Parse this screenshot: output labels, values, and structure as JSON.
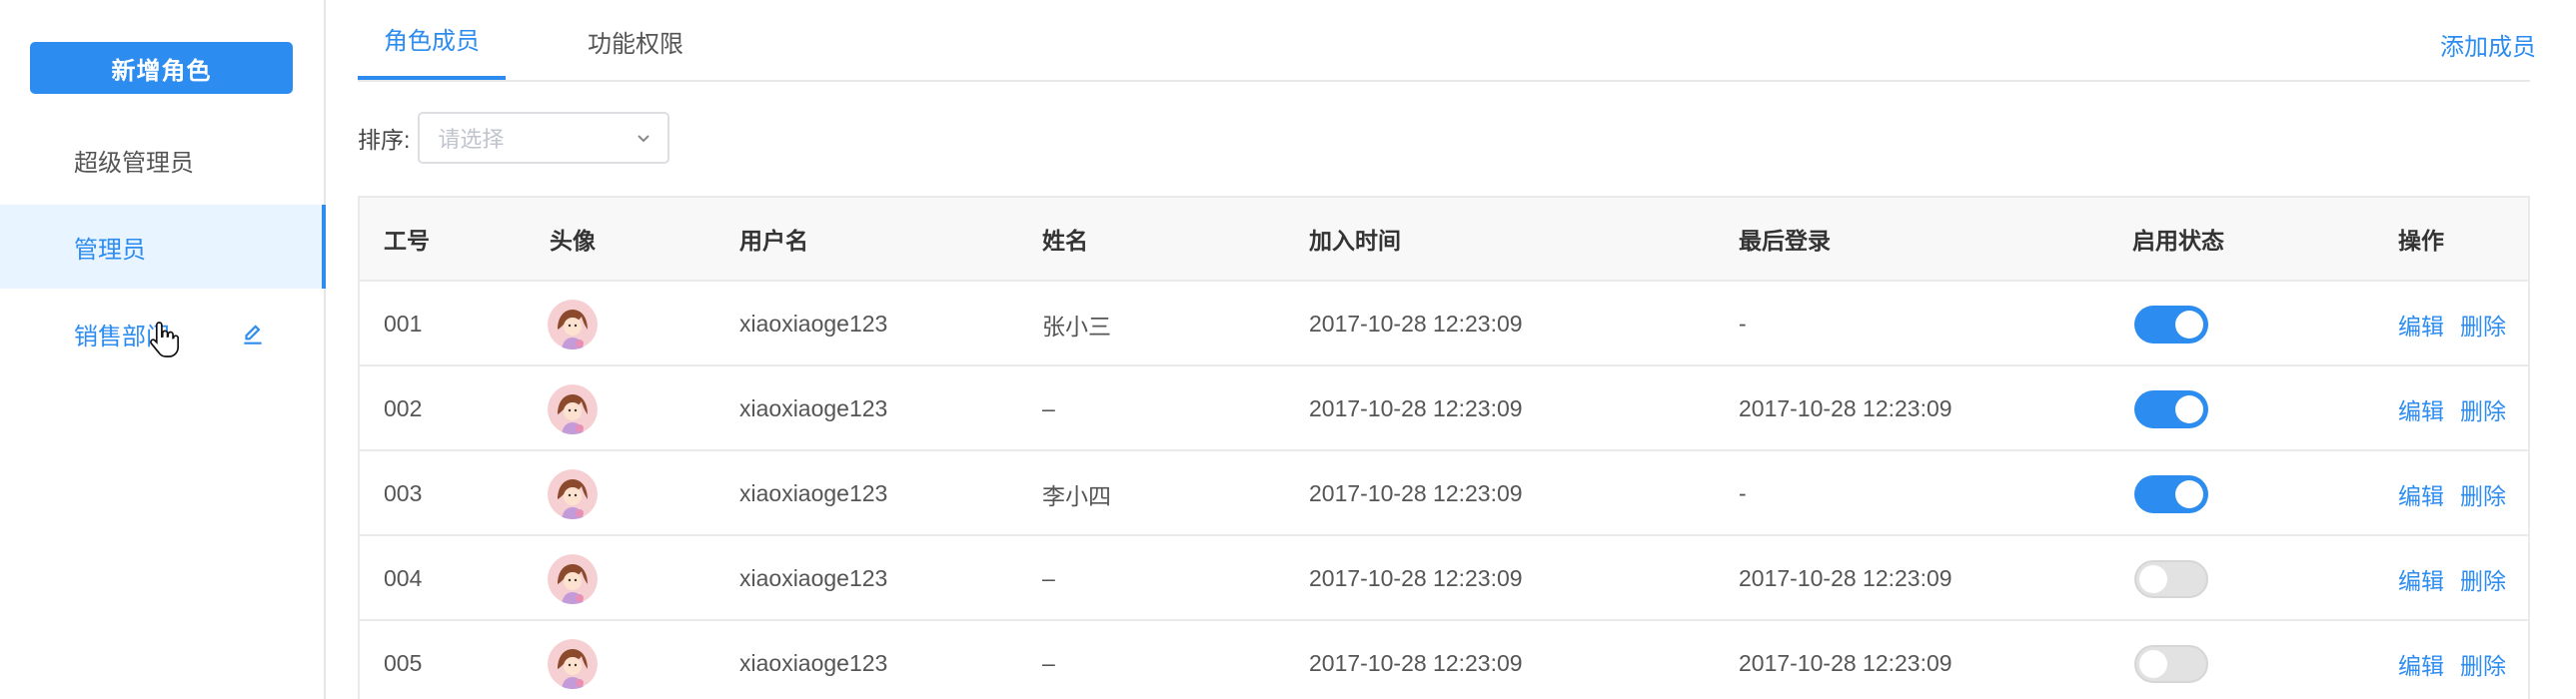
{
  "sidebar": {
    "new_role_label": "新增角色",
    "items": [
      {
        "label": "超级管理员"
      },
      {
        "label": "管理员"
      },
      {
        "label": "销售部门"
      }
    ]
  },
  "tabs": [
    {
      "label": "角色成员"
    },
    {
      "label": "功能权限"
    }
  ],
  "add_member_label": "添加成员",
  "sort": {
    "label": "排序:",
    "placeholder": "请选择"
  },
  "table": {
    "headers": [
      "工号",
      "头像",
      "用户名",
      "姓名",
      "加入时间",
      "最后登录",
      "启用状态",
      "操作"
    ],
    "rows": [
      {
        "id": "001",
        "username": "xiaoxiaoge123",
        "name": "张小三",
        "joined": "2017-10-28 12:23:09",
        "last_login": "-",
        "enabled": true
      },
      {
        "id": "002",
        "username": "xiaoxiaoge123",
        "name": "–",
        "joined": "2017-10-28 12:23:09",
        "last_login": "2017-10-28 12:23:09",
        "enabled": true
      },
      {
        "id": "003",
        "username": "xiaoxiaoge123",
        "name": "李小四",
        "joined": "2017-10-28 12:23:09",
        "last_login": "-",
        "enabled": true
      },
      {
        "id": "004",
        "username": "xiaoxiaoge123",
        "name": "–",
        "joined": "2017-10-28 12:23:09",
        "last_login": "2017-10-28 12:23:09",
        "enabled": false
      },
      {
        "id": "005",
        "username": "xiaoxiaoge123",
        "name": "–",
        "joined": "2017-10-28 12:23:09",
        "last_login": "2017-10-28 12:23:09",
        "enabled": false
      }
    ],
    "actions": {
      "edit": "编辑",
      "delete": "删除"
    }
  },
  "colors": {
    "accent": "#2d8cf0",
    "active_bg": "#e8f4ff",
    "toggle_off": "#e2e2e2"
  },
  "icons": {
    "edit": "pencil-icon",
    "cursor": "hand-pointer-icon",
    "select": "chevron-down-icon",
    "avatar": "cartoon-girl-avatar"
  }
}
